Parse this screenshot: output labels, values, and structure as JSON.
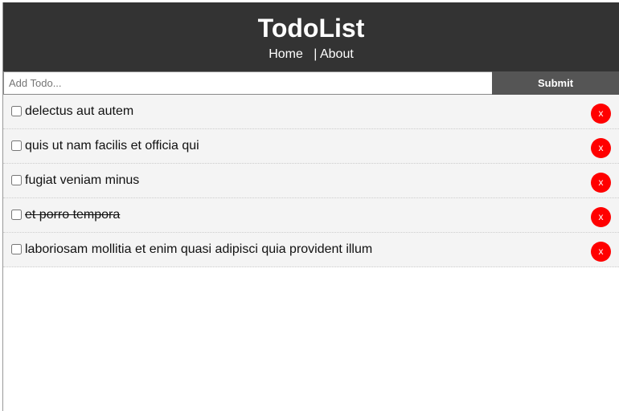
{
  "header": {
    "title": "TodoList",
    "nav": {
      "home": "Home",
      "separator": "|",
      "about": "About"
    }
  },
  "add_form": {
    "placeholder": "Add Todo...",
    "submit_label": "Submit"
  },
  "todos": [
    {
      "title": "delectus aut autem",
      "completed": false,
      "delete_label": "x"
    },
    {
      "title": "quis ut nam facilis et officia qui",
      "completed": false,
      "delete_label": "x"
    },
    {
      "title": "fugiat veniam minus",
      "completed": false,
      "delete_label": "x"
    },
    {
      "title": "et porro tempora",
      "completed": true,
      "delete_label": "x"
    },
    {
      "title": "laboriosam mollitia et enim quasi adipisci quia provident illum",
      "completed": false,
      "delete_label": "x"
    }
  ],
  "colors": {
    "header_bg": "#333333",
    "submit_bg": "#555555",
    "item_bg": "#f4f4f4",
    "delete_bg": "#ff0000"
  }
}
